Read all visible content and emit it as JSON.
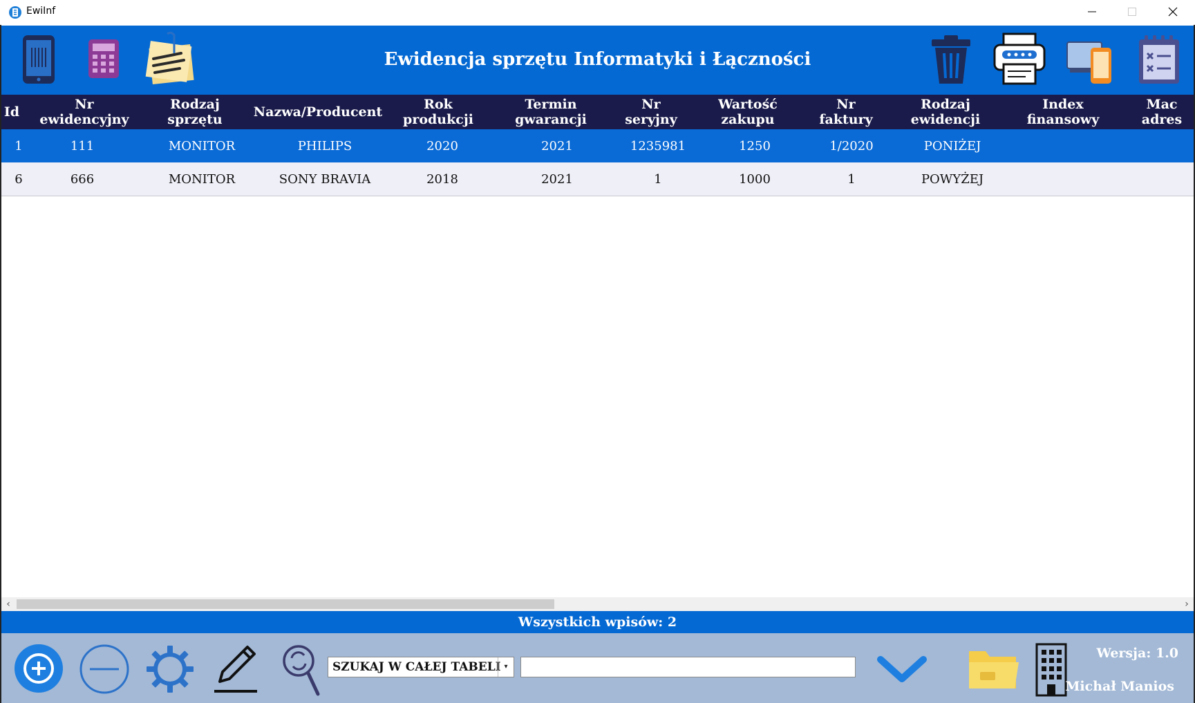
{
  "window": {
    "title": "EwiInf",
    "controls": [
      "minimize",
      "maximize",
      "close"
    ]
  },
  "header": {
    "title": "Ewidencja sprzętu Informatyki i Łączności",
    "left_icons": [
      "phone-icon",
      "calculator-icon",
      "notes-icon"
    ],
    "right_icons": [
      "trash-icon",
      "printer-icon",
      "devices-icon",
      "checklist-icon"
    ]
  },
  "table": {
    "columns": [
      {
        "line1": "Id",
        "line2": ""
      },
      {
        "line1": "Nr",
        "line2": "ewidencyjny"
      },
      {
        "line1": "Rodzaj",
        "line2": "sprzętu"
      },
      {
        "line1": "Nazwa/Producent",
        "line2": ""
      },
      {
        "line1": "Rok",
        "line2": "produkcji"
      },
      {
        "line1": "Termin",
        "line2": "gwarancji"
      },
      {
        "line1": "Nr",
        "line2": "seryjny"
      },
      {
        "line1": "Wartość",
        "line2": "zakupu"
      },
      {
        "line1": "Nr",
        "line2": "faktury"
      },
      {
        "line1": "Rodzaj",
        "line2": "ewidencji"
      },
      {
        "line1": "Index",
        "line2": "finansowy"
      },
      {
        "line1": "Mac",
        "line2": "adres"
      }
    ],
    "rows": [
      [
        "1",
        "111",
        "MONITOR",
        "PHILIPS",
        "2020",
        "2021",
        "1235981",
        "1250",
        "1/2020",
        "PONIŻEJ",
        "",
        ""
      ],
      [
        "6",
        "666",
        "MONITOR",
        "SONY BRAVIA",
        "2018",
        "2021",
        "1",
        "1000",
        "1",
        "POWYŻEJ",
        "",
        ""
      ]
    ],
    "selected_row": 0
  },
  "status": {
    "text": "Wszystkich wpisów: 2"
  },
  "toolbar": {
    "icons": [
      "add-icon",
      "remove-icon",
      "settings-icon",
      "edit-icon",
      "search-refresh-icon",
      "confirm-check-icon",
      "folder-icon",
      "building-icon"
    ],
    "search_scope": "SZUKAJ W CAŁEJ TABELI",
    "search_value": "",
    "version": "Wersja: 1.0",
    "author": "Michał Manios"
  },
  "colors": {
    "header_blue": "#0569d3",
    "column_header_navy": "#1a1b4a",
    "selected_row": "#0a6ad6",
    "toolbar_bg": "#a3b9d6"
  }
}
